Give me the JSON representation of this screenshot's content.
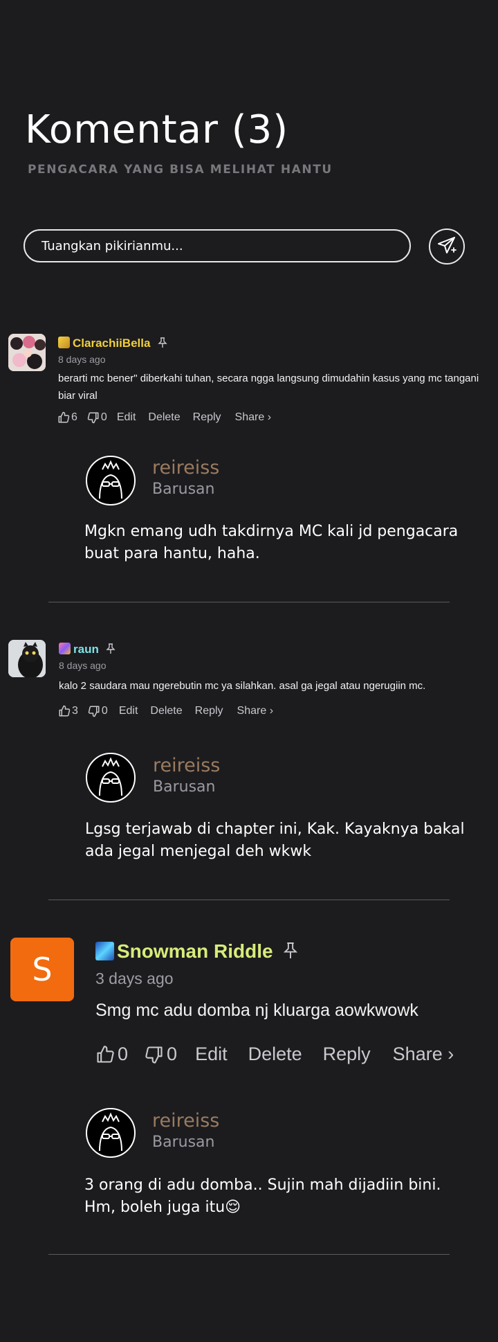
{
  "header": {
    "title": "Komentar (3)",
    "subtitle": "PENGACARA YANG BISA MELIHAT HANTU"
  },
  "input": {
    "placeholder": "Tuangkan pikirianmu..."
  },
  "send_button_icon": "send-icon",
  "colors": {
    "background": "#1c1c1f",
    "username_yellow": "#f2cf3c",
    "username_cyan": "#7ee3e8",
    "username_lime": "#d7ec7a",
    "reply_name": "#9a7b5f",
    "avatar_orange": "#f26b0f"
  },
  "comments": [
    {
      "username": "ClarachiiBella",
      "time": "8 days ago",
      "text": "berarti mc bener\" diberkahi tuhan, secara ngga langsung dimudahin kasus yang mc tangani biar viral",
      "likes": "6",
      "dislikes": "0",
      "edit": "Edit",
      "delete": "Delete",
      "reply": "Reply",
      "share": "Share ›",
      "reply_block": {
        "name": "reireiss",
        "time": "Barusan",
        "text": "Mgkn emang udh takdirnya MC kali jd pengacara buat para hantu, haha."
      }
    },
    {
      "username": "raun",
      "time": "8 days ago",
      "text": "kalo 2 saudara mau ngerebutin mc ya silahkan. asal ga jegal atau ngerugiin mc.",
      "likes": "3",
      "dislikes": "0",
      "edit": "Edit",
      "delete": "Delete",
      "reply": "Reply",
      "share": "Share ›",
      "reply_block": {
        "name": "reireiss",
        "time": "Barusan",
        "text": "Lgsg terjawab di chapter ini, Kak. Kayaknya bakal ada jegal menjegal deh wkwk"
      }
    },
    {
      "avatar_letter": "S",
      "username": "Snowman Riddle",
      "time": "3 days ago",
      "text": "Smg mc adu domba nj kluarga aowkwowk",
      "likes": "0",
      "dislikes": "0",
      "edit": "Edit",
      "delete": "Delete",
      "reply": "Reply",
      "share": "Share ›",
      "reply_block": {
        "name": "reireiss",
        "time": "Barusan",
        "text": "3 orang di adu domba.. Sujin mah dijadiin bini. Hm, boleh juga itu😌"
      }
    }
  ]
}
